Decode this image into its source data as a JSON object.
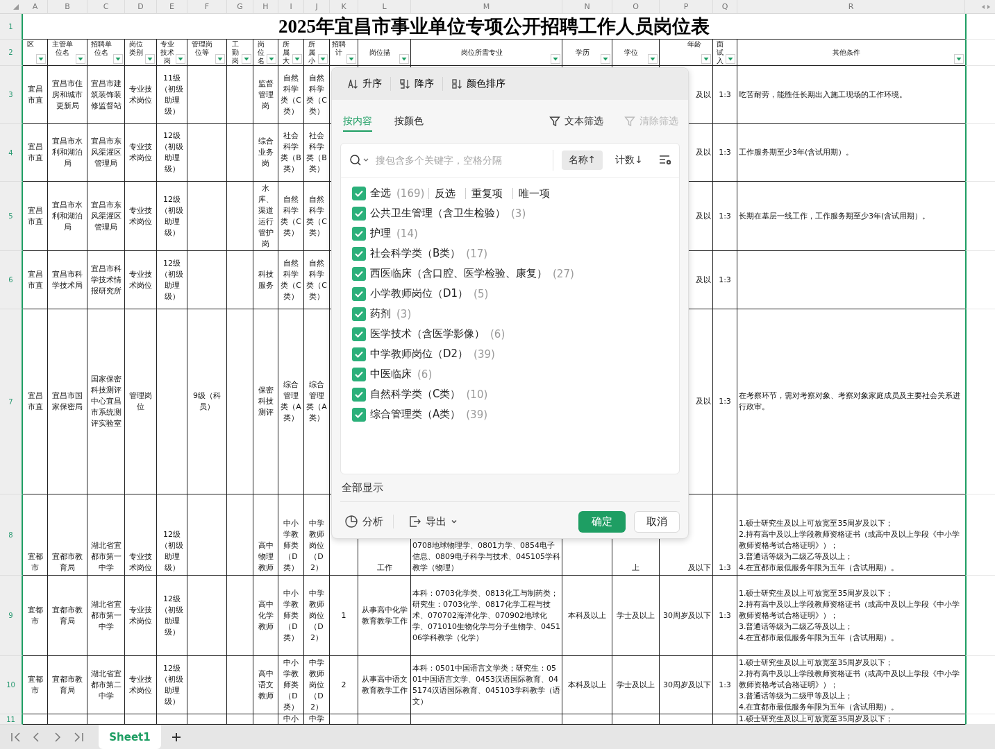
{
  "columns": [
    {
      "letter": "A",
      "header": "区"
    },
    {
      "letter": "B",
      "header": "主管单位名"
    },
    {
      "letter": "C",
      "header": "招聘单位名"
    },
    {
      "letter": "D",
      "header": "岗位类别"
    },
    {
      "letter": "E",
      "header": "专业技术岗"
    },
    {
      "letter": "F",
      "header": "管理岗位等"
    },
    {
      "letter": "G",
      "header": "工勤岗"
    },
    {
      "letter": "H",
      "header": "岗位名"
    },
    {
      "letter": "I",
      "header": "所属大"
    },
    {
      "letter": "J",
      "header": "所属小"
    },
    {
      "letter": "K",
      "header": "招聘计"
    },
    {
      "letter": "L",
      "header": "岗位描"
    },
    {
      "letter": "M",
      "header": "岗位所需专业"
    },
    {
      "letter": "N",
      "header": "学历"
    },
    {
      "letter": "O",
      "header": "学位"
    },
    {
      "letter": "P",
      "header": "年龄"
    },
    {
      "letter": "Q",
      "header": "面试入"
    },
    {
      "letter": "R",
      "header": "其他条件"
    }
  ],
  "title_row": {
    "number": "1",
    "text": "2025年宜昌市事业单位专项公开招聘工作人员岗位表"
  },
  "header_row": {
    "number": "2"
  },
  "rows": [
    {
      "number": "3",
      "cells": {
        "A": "宜昌市直",
        "B": "宜昌市住房和城市更新局",
        "C": "宜昌市建筑装饰装修监督站",
        "D": "专业技术岗位",
        "E": "11级（初级助理级）",
        "H": "监督管理岗",
        "I": "自然科学类（C类）",
        "J": "自然科学类（C类）",
        "P": "及以",
        "Q": "1:3",
        "R": "吃苦耐劳，能胜任长期出入施工现场的工作环境。"
      }
    },
    {
      "number": "4",
      "cells": {
        "A": "宜昌市直",
        "B": "宜昌市水利和湖泊局",
        "C": "宜昌市东风渠灌区管理局",
        "D": "专业技术岗位",
        "E": "12级（初级助理级）",
        "H": "综合业务岗",
        "I": "社会科学类（B类）",
        "J": "社会科学类（B类）",
        "P": "及以",
        "Q": "1:3",
        "R": "工作服务期至少3年(含试用期）。"
      }
    },
    {
      "number": "5",
      "cells": {
        "A": "宜昌市直",
        "B": "宜昌市水利和湖泊局",
        "C": "宜昌市东风渠灌区管理局",
        "D": "专业技术岗位",
        "E": "12级（初级助理级）",
        "H": "水库、渠道运行管护岗",
        "I": "自然科学类（C类）",
        "J": "自然科学类（C类）",
        "P": "及以",
        "Q": "1:3",
        "R": "长期在基层一线工作，工作服务期至少3年(含试用期）。"
      }
    },
    {
      "number": "6",
      "cells": {
        "A": "宜昌市直",
        "B": "宜昌市科学技术局",
        "C": "宜昌市科学技术情报研究所",
        "D": "专业技术岗位",
        "E": "12级（初级助理级）",
        "H": "科技服务",
        "I": "自然科学类（C类）",
        "J": "自然科学类（C类）",
        "P": "及以",
        "Q": "1:3"
      }
    },
    {
      "number": "7",
      "cells": {
        "A": "宜昌市直",
        "B": "宜昌市国家保密局",
        "C": "国家保密科技测评中心宜昌市系统测评实验室",
        "D": "管理岗位",
        "F": "9级（科员）",
        "H": "保密科技测评",
        "I": "综合管理类（A类）",
        "J": "综合管理类（A类）",
        "P": "及以",
        "Q": "1:3",
        "R": "在考察环节，需对考察对象、考察对象家庭成员及主要社会关系进行政审。"
      }
    },
    {
      "number": "8",
      "cells": {
        "A": "宜都市",
        "B": "宜都市教育局",
        "C": "湖北省宜都市第一中学",
        "D": "专业技术岗位",
        "E": "12级（初级助理级）",
        "H": "高中物理教师",
        "I": "中小学教师类（D类）",
        "J": "中学教师岗位（D2）",
        "L": "工作",
        "M": "0708地球物理学、0801力学、0854电子信息、0809电子科学与技术、045105学科教学（物理）",
        "O": "上",
        "P": "及以下",
        "Q": "1:3",
        "R": "1.硕士研究生及以上可放宽至35周岁及以下；\n2.持有高中及以上学段教师资格证书（或高中及以上学段《中小学教师资格考试合格证明》）；\n3.普通话等级为二级乙等及以上；\n4.在宜都市最低服务年限为五年（含试用期）。"
      }
    },
    {
      "number": "9",
      "cells": {
        "A": "宜都市",
        "B": "宜都市教育局",
        "C": "湖北省宜都市第一中学",
        "D": "专业技术岗位",
        "E": "12级（初级助理级）",
        "H": "高中化学教师",
        "I": "中小学教师类（D类）",
        "J": "中学教师岗位（D2）",
        "K": "1",
        "L": "从事高中化学教育教学工作",
        "M": "本科：0703化学类、0813化工与制药类；研究生：0703化学、0817化学工程与技术、070702海洋化学、070902地球化学、071010生物化学与分子生物学、045106学科教学（化学）",
        "N": "本科及以上",
        "O": "学士及以上",
        "P": "30周岁及以下",
        "Q": "1:3",
        "R": "1.硕士研究生及以上可放宽至35周岁及以下；\n2.持有高中及以上学段教师资格证书（或高中及以上学段《中小学教师资格考试合格证明》）；\n3.普通话等级为二级乙等及以上；\n4.在宜都市最低服务年限为五年（含试用期）。"
      }
    },
    {
      "number": "10",
      "cells": {
        "A": "宜都市",
        "B": "宜都市教育局",
        "C": "湖北省宜都市第二中学",
        "D": "专业技术岗位",
        "E": "12级（初级助理级）",
        "H": "高中语文教师",
        "I": "中小学教师类（D类）",
        "J": "中学教师岗位（D2）",
        "K": "2",
        "L": "从事高中语文教育教学工作",
        "M": "本科：0501中国语言文学类；研究生：0501中国语言文学、0453汉语国际教育、045174汉语国际教育、045103学科教学（语文）",
        "N": "本科及以上",
        "O": "学士及以上",
        "P": "30周岁及以下",
        "Q": "1:3",
        "R": "1.硕士研究生及以上可放宽至35周岁及以下；\n2.持有高中及以上学段教师资格证书（或高中及以上学段《中小学教师资格考试合格证明》）；\n3.普通话等级为二级甲等及以上；\n4.在宜都市最低服务年限为五年（含试用期）。"
      }
    },
    {
      "number": "11",
      "cells": {
        "I": "中小",
        "J": "中学",
        "R": "1.硕士研究生及以上可放宽至35周岁及以下；"
      }
    }
  ],
  "filter_popup": {
    "sort_buttons": [
      {
        "kind": "ascending",
        "label": "升序"
      },
      {
        "kind": "descending",
        "label": "降序"
      },
      {
        "kind": "color",
        "label": "颜色排序"
      }
    ],
    "tabs": [
      {
        "label": "按内容",
        "selected": true
      },
      {
        "label": "按颜色",
        "selected": false
      }
    ],
    "text_filter": "文本筛选",
    "clear_filter": {
      "label": "清除筛选",
      "disabled": true
    },
    "search": {
      "placeholder": "搜包含多个关键字，空格分隔"
    },
    "sort_options": [
      {
        "label": "名称↑",
        "selected": true
      },
      {
        "label": "计数↓",
        "selected": false
      }
    ],
    "select_all": {
      "label": "全选",
      "count": "(169)",
      "checked": true
    },
    "quick_actions": [
      "反选",
      "重复项",
      "唯一项"
    ],
    "items": [
      {
        "label": "公共卫生管理（含卫生检验）",
        "count": "(3)",
        "checked": true
      },
      {
        "label": "护理",
        "count": "(14)",
        "checked": true
      },
      {
        "label": "社会科学类（B类）",
        "count": "(17)",
        "checked": true
      },
      {
        "label": "西医临床（含口腔、医学检验、康复）",
        "count": "(27)",
        "checked": true
      },
      {
        "label": "小学教师岗位（D1）",
        "count": "(5)",
        "checked": true
      },
      {
        "label": "药剂",
        "count": "(3)",
        "checked": true
      },
      {
        "label": "医学技术（含医学影像）",
        "count": "(6)",
        "checked": true
      },
      {
        "label": "中学教师岗位（D2）",
        "count": "(39)",
        "checked": true
      },
      {
        "label": "中医临床",
        "count": "(6)",
        "checked": true
      },
      {
        "label": "自然科学类（C类）",
        "count": "(10)",
        "checked": true
      },
      {
        "label": "综合管理类（A类）",
        "count": "(39)",
        "checked": true
      }
    ],
    "show_all": "全部显示",
    "analyze": "分析",
    "export": "导出",
    "ok": "确定",
    "cancel": "取消"
  },
  "sheet_tabs": [
    {
      "label": "Sheet1",
      "selected": true
    }
  ]
}
